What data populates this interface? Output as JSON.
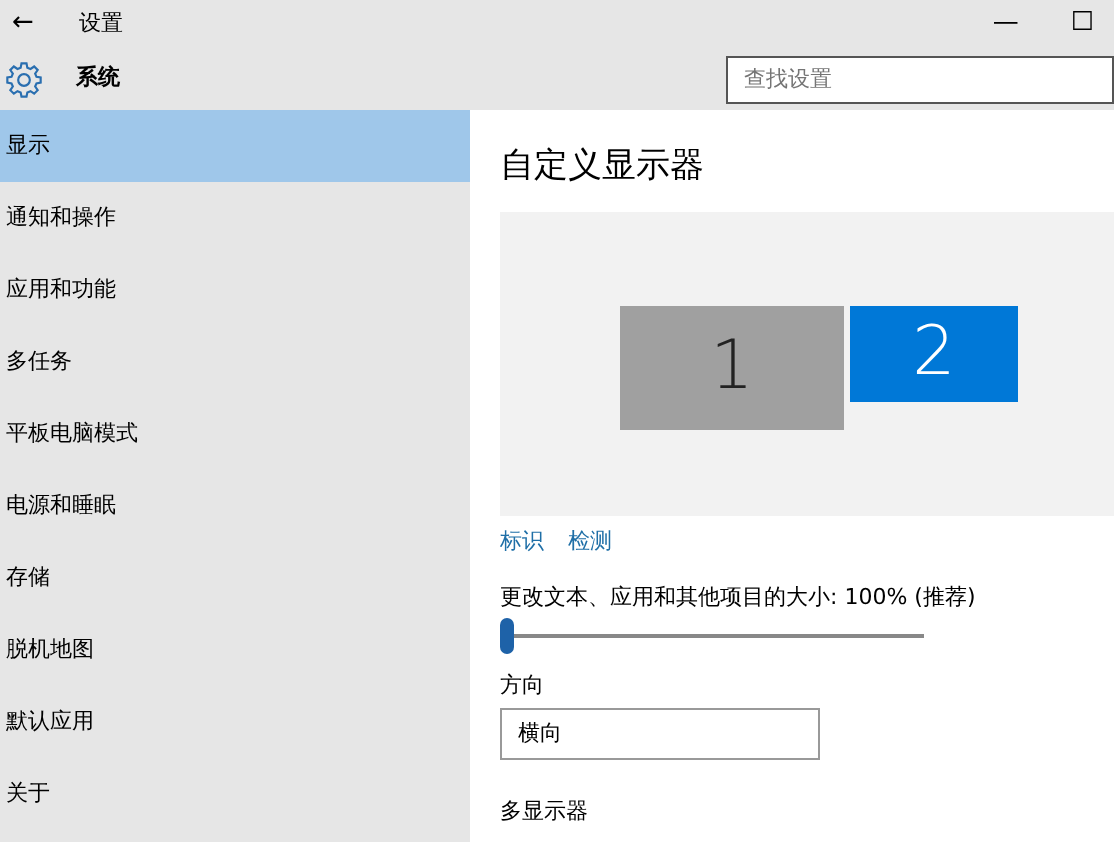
{
  "window": {
    "title": "设置",
    "back": "←",
    "minimize": "—",
    "maximize": "☐"
  },
  "header": {
    "title": "系统",
    "search": {
      "placeholder": "查找设置"
    }
  },
  "sidebar": {
    "items": [
      {
        "label": "显示",
        "selected": true
      },
      {
        "label": "通知和操作",
        "selected": false
      },
      {
        "label": "应用和功能",
        "selected": false
      },
      {
        "label": "多任务",
        "selected": false
      },
      {
        "label": "平板电脑模式",
        "selected": false
      },
      {
        "label": "电源和睡眠",
        "selected": false
      },
      {
        "label": "存储",
        "selected": false
      },
      {
        "label": "脱机地图",
        "selected": false
      },
      {
        "label": "默认应用",
        "selected": false
      },
      {
        "label": "关于",
        "selected": false
      }
    ]
  },
  "content": {
    "title": "自定义显示器",
    "monitors": [
      {
        "label": "1",
        "selected": false
      },
      {
        "label": "2",
        "selected": true
      }
    ],
    "links": [
      "标识",
      "检测"
    ],
    "scale": {
      "label": "更改文本、应用和其他项目的大小: 100% (推荐)",
      "level": 0
    },
    "orientation": {
      "label": "方向",
      "value": "横向"
    },
    "section": "多显示器"
  }
}
